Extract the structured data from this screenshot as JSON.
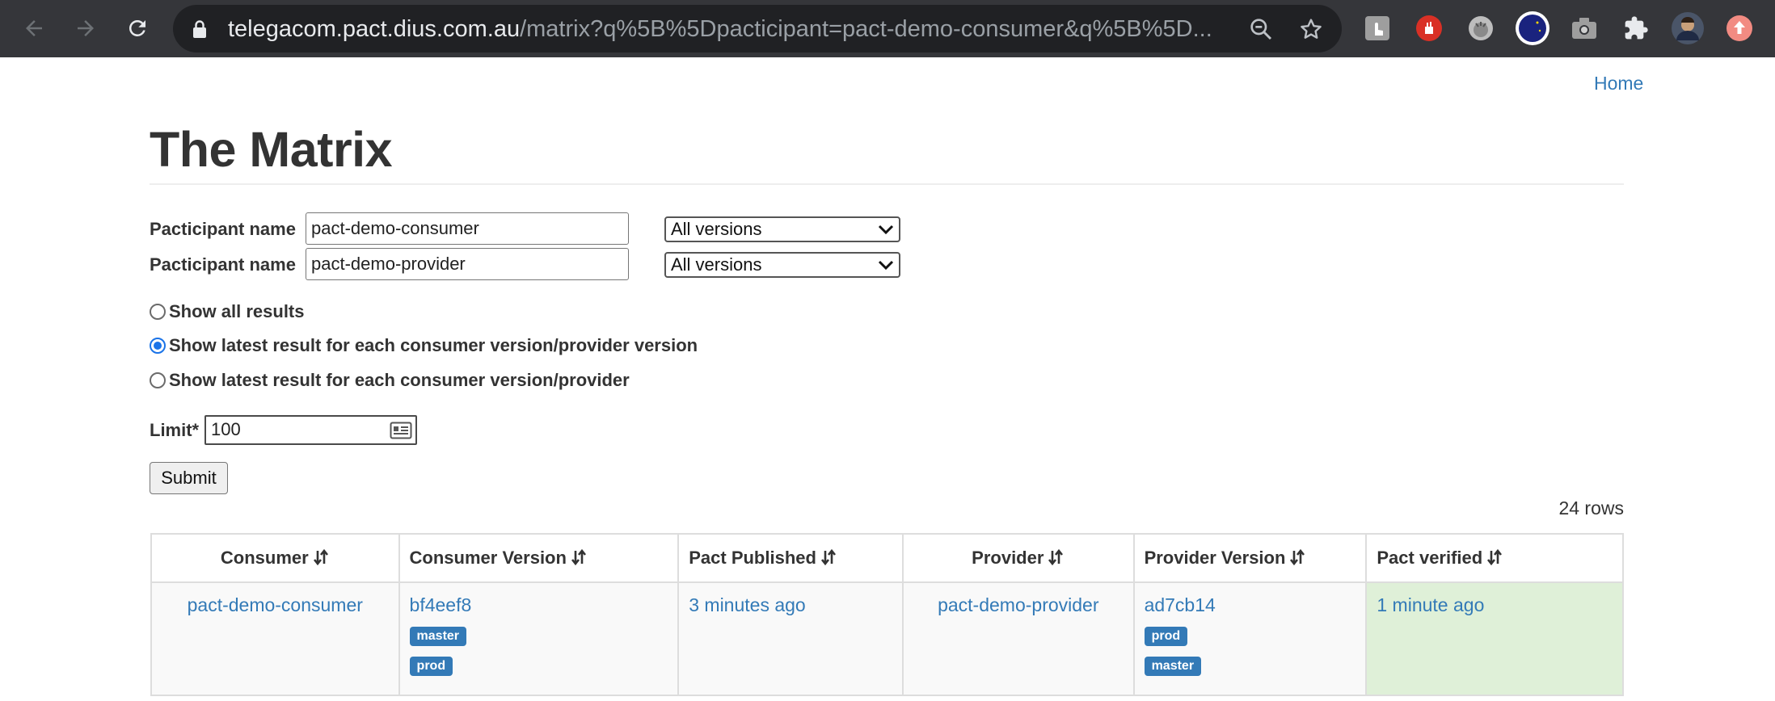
{
  "browser": {
    "url_host": "telegacom.pact.dius.com.au",
    "url_path": "/matrix?q%5B%5Dpacticipant=pact-demo-consumer&q%5B%5D..."
  },
  "page": {
    "home_link": "Home",
    "title": "The Matrix",
    "participants": [
      {
        "label": "Pacticipant name",
        "value": "pact-demo-consumer",
        "version_option": "All versions"
      },
      {
        "label": "Pacticipant name",
        "value": "pact-demo-provider",
        "version_option": "All versions"
      }
    ],
    "radio_options": [
      {
        "label": "Show all results",
        "checked": false
      },
      {
        "label": "Show latest result for each consumer version/provider version",
        "checked": true
      },
      {
        "label": "Show latest result for each consumer version/provider",
        "checked": false
      }
    ],
    "limit_label": "Limit*",
    "limit_value": "100",
    "submit_label": "Submit",
    "row_count": "24 rows"
  },
  "table": {
    "headers": [
      "Consumer",
      "Consumer Version",
      "Pact Published",
      "Provider",
      "Provider Version",
      "Pact verified"
    ],
    "rows": [
      {
        "consumer": "pact-demo-consumer",
        "consumer_version": "bf4eef8",
        "consumer_tags": [
          "master",
          "prod"
        ],
        "pact_published": "3 minutes ago",
        "provider": "pact-demo-provider",
        "provider_version": "ad7cb14",
        "provider_tags": [
          "prod",
          "master"
        ],
        "pact_verified": "1 minute ago"
      }
    ]
  },
  "colors": {
    "link": "#337ab7",
    "tag_bg": "#337ab7",
    "verified_bg": "#dff0d8",
    "chrome_bg": "#35363a"
  }
}
